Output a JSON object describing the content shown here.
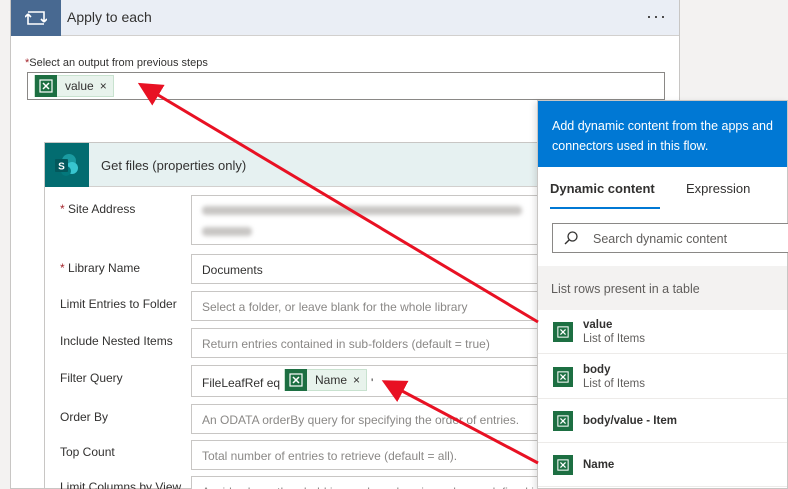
{
  "apply_each": {
    "title": "Apply to each",
    "more_label": "···",
    "select_label": "Select an output from previous steps",
    "required_mark": "*",
    "token": {
      "label": "value",
      "remove": "×"
    }
  },
  "get_files": {
    "title": "Get files (properties only)",
    "fields": [
      {
        "label": "Site Address",
        "required": true,
        "value": ""
      },
      {
        "label": "Library Name",
        "required": true,
        "value": "Documents"
      },
      {
        "label": "Limit Entries to Folder",
        "required": false,
        "placeholder": "Select a folder, or leave blank for the whole library"
      },
      {
        "label": "Include Nested Items",
        "required": false,
        "placeholder": "Return entries contained in sub-folders (default = true)"
      },
      {
        "label": "Filter Query",
        "required": false,
        "value": "FileLeafRef eq '",
        "token": {
          "label": "Name",
          "remove": "×"
        },
        "suffix": "'"
      },
      {
        "label": "Order By",
        "required": false,
        "placeholder": "An ODATA orderBy query for specifying the order of entries."
      },
      {
        "label": "Top Count",
        "required": false,
        "placeholder": "Total number of entries to retrieve (default = all)."
      },
      {
        "label": "Limit Columns by View",
        "required": false,
        "placeholder": "Avoid column threshold issues by only using columns defined in"
      }
    ]
  },
  "dynamic_panel": {
    "header": "Add dynamic content from the apps and connectors used in this flow.",
    "tabs": [
      "Dynamic content",
      "Expression"
    ],
    "search_placeholder": "Search dynamic content",
    "section": "List rows present in a table",
    "items": [
      {
        "name": "value",
        "sub": "List of Items"
      },
      {
        "name": "body",
        "sub": "List of Items"
      },
      {
        "name": "body/value - Item",
        "sub": ""
      },
      {
        "name": "Name",
        "sub": ""
      }
    ]
  },
  "colors": {
    "accent": "#0078d4",
    "apply_icon": "#486991",
    "sharepoint": "#036c70",
    "excel": "#1d6f42",
    "arrow": "#e81123"
  },
  "icons": [
    "loop-icon",
    "sharepoint-icon",
    "excel-icon",
    "search-icon",
    "more-icon"
  ]
}
